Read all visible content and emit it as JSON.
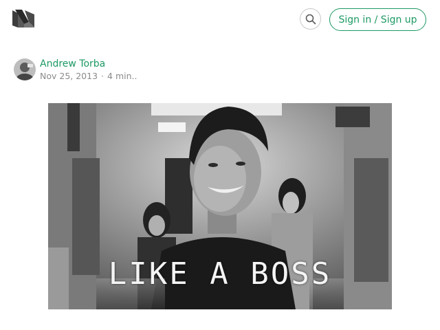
{
  "header": {
    "logo_icon": "medium-logo-icon",
    "search_icon": "search-icon",
    "signin_label": "Sign in / Sign up",
    "accent_color": "#1c9963"
  },
  "post": {
    "author": "Andrew Torba",
    "date": "Nov 25, 2013",
    "separator": "·",
    "read_time": "4 min.."
  },
  "hero": {
    "caption": "LIKE A BOSS"
  }
}
